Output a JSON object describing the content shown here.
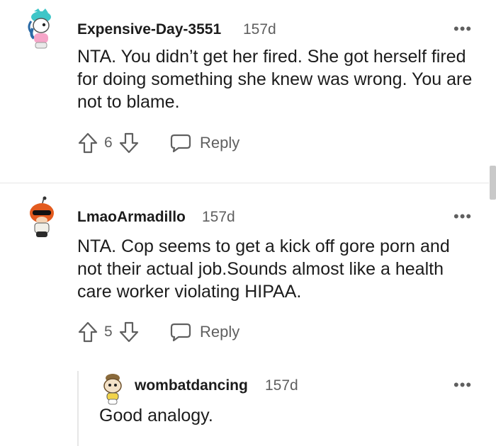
{
  "comments": [
    {
      "username": "Expensive-Day-3551",
      "age": "157d",
      "text": "NTA. You didn’t get her fired. She got herself fired for doing something she knew was wrong. You are not to blame.",
      "votes": "6",
      "reply_label": "Reply",
      "avatar_icon": "unicorn-avatar-icon"
    },
    {
      "username": "LmaoArmadillo",
      "age": "157d",
      "text": "NTA. Cop seems to get a kick off gore porn and not their actual job.Sounds almost like a health care worker violating HIPAA.",
      "votes": "5",
      "reply_label": "Reply",
      "avatar_icon": "snoo-sunglasses-avatar-icon"
    },
    {
      "username": "wombatdancing",
      "age": "157d",
      "text": "Good analogy.",
      "avatar_icon": "snoo-hat-avatar-icon"
    }
  ],
  "more_options_label": "•••",
  "colors": {
    "text": "#1c1c1c",
    "meta": "#5f5f5f",
    "divider": "#e5e5e5",
    "scrollbar": "#c9c9c9"
  }
}
